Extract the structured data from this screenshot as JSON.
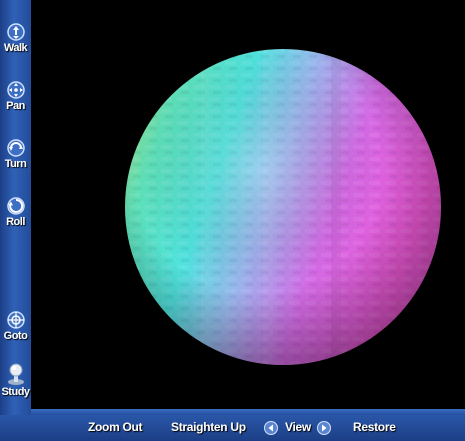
{
  "toolbar": {
    "items": [
      {
        "label": "Walk",
        "icon": "walk-icon"
      },
      {
        "label": "Pan",
        "icon": "pan-icon"
      },
      {
        "label": "Turn",
        "icon": "turn-icon"
      },
      {
        "label": "Roll",
        "icon": "roll-icon"
      },
      {
        "label": "Goto",
        "icon": "goto-icon"
      },
      {
        "label": "Study",
        "icon": "study-icon"
      }
    ]
  },
  "navbar": {
    "zoom_out": "Zoom Out",
    "straighten_up": "Straighten Up",
    "view": "View",
    "restore": "Restore",
    "prev_view_icon": "arrow-left-icon",
    "next_view_icon": "arrow-right-icon"
  },
  "scene": {
    "object": "sphere",
    "colors": [
      "#a6e07a",
      "#4fe6d4",
      "#a6b0ee",
      "#e85ee0"
    ],
    "background": "#000000"
  }
}
